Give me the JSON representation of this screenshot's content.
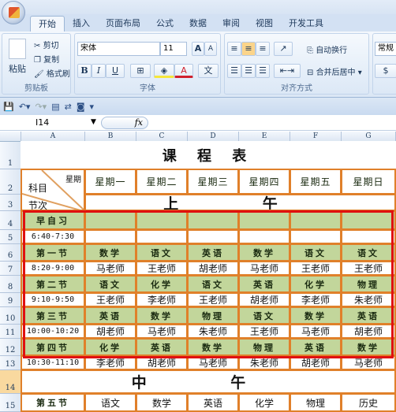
{
  "ribbon": {
    "tabs": [
      "开始",
      "插入",
      "页面布局",
      "公式",
      "数据",
      "审阅",
      "视图",
      "开发工具"
    ],
    "active_tab": "开始",
    "clipboard": {
      "label": "剪贴板",
      "paste": "粘贴",
      "cut": "剪切",
      "copy": "复制",
      "format_painter": "格式刷"
    },
    "font": {
      "label": "字体",
      "font_name": "宋体",
      "font_size": "11",
      "bold": "B",
      "italic": "I",
      "underline": "U",
      "grow": "A",
      "shrink": "A",
      "fill_color": "#f5e63c",
      "font_color": "#d0202c",
      "phonetic": "文"
    },
    "alignment": {
      "label": "对齐方式",
      "wrap": "自动换行",
      "merge": "合并后居中"
    },
    "number": {
      "format": "常规"
    }
  },
  "formula_bar": {
    "name_box": "I14",
    "fx": "fx",
    "value": ""
  },
  "columns": [
    "A",
    "B",
    "C",
    "D",
    "E",
    "F",
    "G"
  ],
  "rows": [
    "1",
    "2",
    "3",
    "4",
    "5",
    "6",
    "7",
    "8",
    "9",
    "10",
    "11",
    "12",
    "13",
    "14",
    "15"
  ],
  "sheet": {
    "title": "课 程 表",
    "corner": {
      "top": "星期",
      "mid": "科目",
      "bottom": "节次"
    },
    "days": [
      "星期一",
      "星期二",
      "星期三",
      "星期四",
      "星期五",
      "星期日"
    ],
    "morning": "上 午",
    "noon": "中 午",
    "periods": [
      {
        "name": "早自习",
        "time": "6:40-7:30",
        "subjects": [
          "",
          "",
          "",
          "",
          "",
          ""
        ],
        "teachers": [
          "",
          "",
          "",
          "",
          "",
          ""
        ]
      },
      {
        "name": "第一节",
        "time": "8:20-9:00",
        "subjects": [
          "数学",
          "语文",
          "英语",
          "数学",
          "语文",
          "语文"
        ],
        "teachers": [
          "马老师",
          "王老师",
          "胡老师",
          "马老师",
          "王老师",
          "王老师"
        ]
      },
      {
        "name": "第二节",
        "time": "9:10-9:50",
        "subjects": [
          "语文",
          "化学",
          "语文",
          "英语",
          "化学",
          "物理"
        ],
        "teachers": [
          "王老师",
          "李老师",
          "王老师",
          "胡老师",
          "李老师",
          "朱老师"
        ]
      },
      {
        "name": "第三节",
        "time": "10:00-10:20",
        "subjects": [
          "英语",
          "数学",
          "物理",
          "语文",
          "数学",
          "英语"
        ],
        "teachers": [
          "胡老师",
          "马老师",
          "朱老师",
          "王老师",
          "马老师",
          "胡老师"
        ]
      },
      {
        "name": "第四节",
        "time": "10:30-11:10",
        "subjects": [
          "化学",
          "英语",
          "数学",
          "物理",
          "英语",
          "数学"
        ],
        "teachers": [
          "李老师",
          "胡老师",
          "马老师",
          "朱老师",
          "胡老师",
          "马老师"
        ]
      }
    ],
    "afternoon_first": {
      "name": "第五节",
      "subjects": [
        "语文",
        "数学",
        "英语",
        "化学",
        "物理",
        "历史"
      ]
    }
  }
}
